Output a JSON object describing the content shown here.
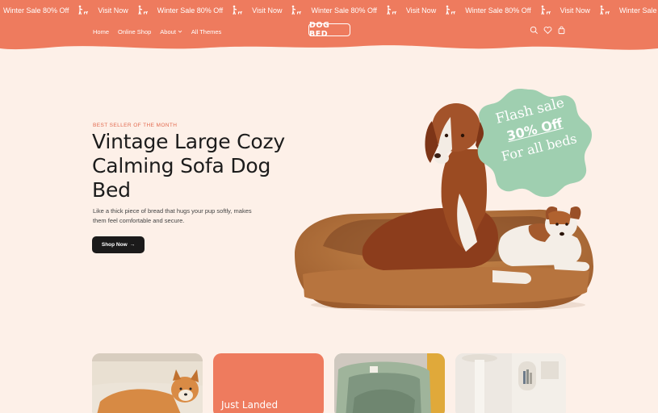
{
  "marquee": {
    "items": [
      {
        "text": "Winter Sale 80% Off"
      },
      {
        "text": "Visit Now"
      },
      {
        "text": "Winter Sale 80% Off"
      },
      {
        "text": "Visit Now"
      },
      {
        "text": "Winter Sale 80% Off"
      },
      {
        "text": "Visit Now"
      },
      {
        "text": "Winter Sale 80% Off"
      },
      {
        "text": "Visit Now"
      },
      {
        "text": "Winter Sale"
      }
    ]
  },
  "nav": {
    "home": "Home",
    "online_shop": "Online Shop",
    "about": "About",
    "all_themes": "All Themes"
  },
  "logo": {
    "text": "DOG BED"
  },
  "hero": {
    "eyebrow": "BEST SELLER OF THE MONTH",
    "title": "Vintage Large Cozy Calming Sofa Dog Bed",
    "description": "Like a thick piece of bread that hugs your pup softly, makes them feel comfortable and secure.",
    "button_label": "Shop Now",
    "button_arrow": "→"
  },
  "badge": {
    "line1": "Flash sale",
    "line2": "30% Off",
    "line3": "For all beds",
    "color": "#9fcfb0"
  },
  "cards": {
    "card2_title": "Just Landed"
  },
  "colors": {
    "accent": "#ee7b5e",
    "background": "#fdf0e8",
    "dark_button": "#1b1a1a"
  },
  "icons": {
    "marquee": "dog-walk-icon",
    "header": [
      "search-icon",
      "heart-icon",
      "bag-icon"
    ]
  }
}
